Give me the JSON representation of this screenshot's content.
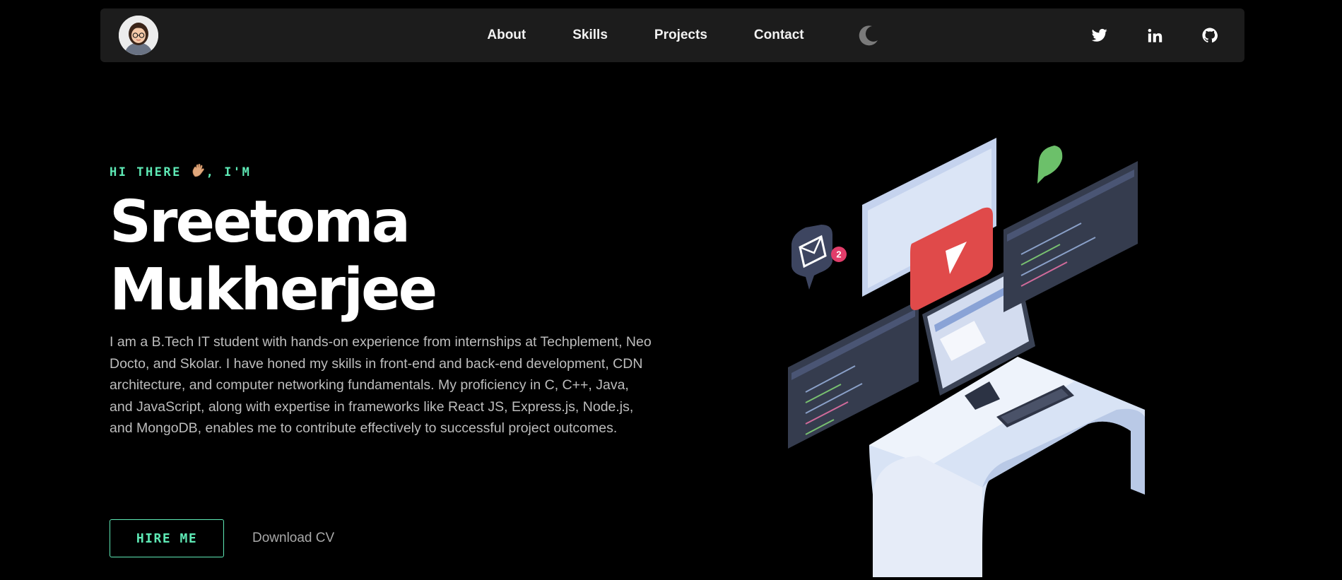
{
  "nav": {
    "links": [
      {
        "label": "About"
      },
      {
        "label": "Skills"
      },
      {
        "label": "Projects"
      },
      {
        "label": "Contact"
      }
    ],
    "theme_icon": "moon-icon",
    "socials": [
      "twitter-icon",
      "linkedin-icon",
      "github-icon"
    ]
  },
  "hero": {
    "greeting_pre": "HI THERE",
    "greeting_post": ", I'M",
    "name_line1": "Sreetoma",
    "name_line2": "Mukherjee",
    "bio": "I am a B.Tech IT student with hands-on experience from internships at Techplement, Neo Docto, and Skolar. I have honed my skills in front-end and back-end development, CDN architecture, and computer networking fundamentals. My proficiency in C, C++, Java, and JavaScript, along with expertise in frameworks like React JS, Express.js, Node.js, and MongoDB, enables me to contribute effectively to successful project outcomes.",
    "hire_label": "HIRE ME",
    "download_label": "Download CV",
    "notification_count": "2"
  },
  "colors": {
    "accent": "#5ee9b5",
    "background": "#000000",
    "navbar": "#1c1c1c"
  }
}
